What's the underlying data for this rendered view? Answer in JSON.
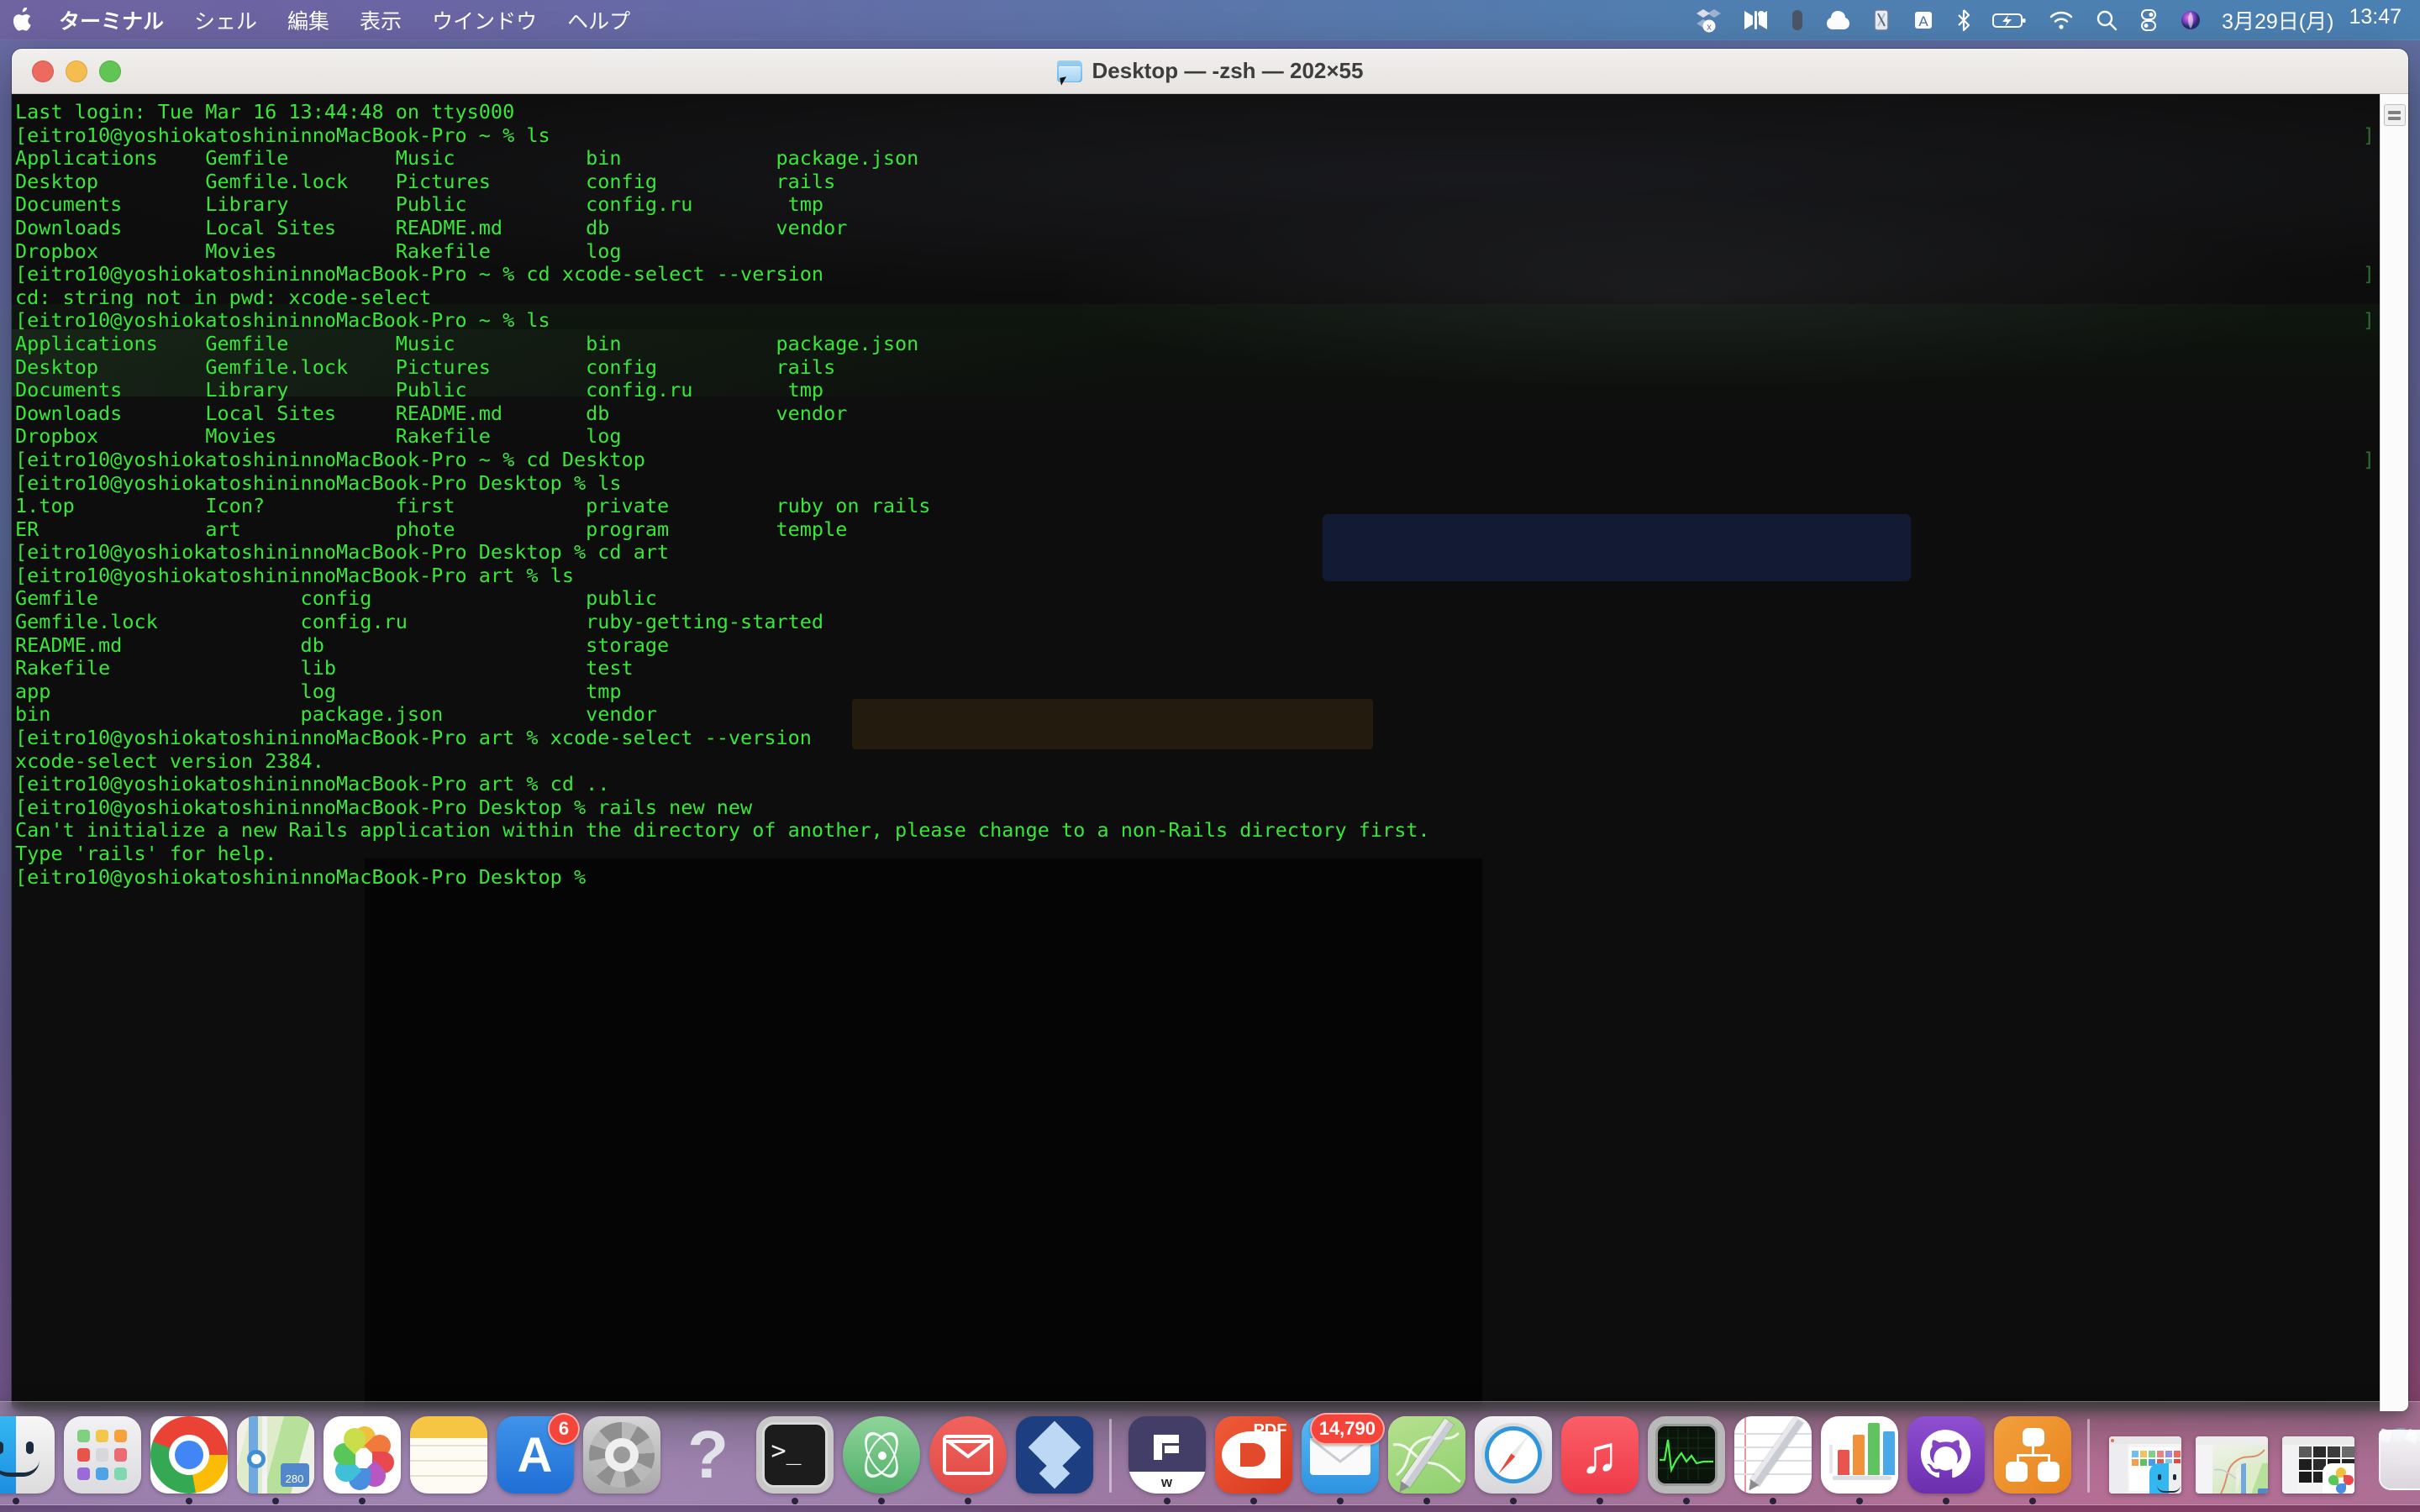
{
  "menubar": {
    "apple_icon": "apple-logo",
    "items": [
      {
        "label": "ターミナル",
        "bold": true
      },
      {
        "label": "シェル",
        "bold": false
      },
      {
        "label": "編集",
        "bold": false
      },
      {
        "label": "表示",
        "bold": false
      },
      {
        "label": "ウインドウ",
        "bold": false
      },
      {
        "label": "ヘルプ",
        "bold": false
      }
    ],
    "status_icons": [
      "dropbox-icon",
      "music-visualizer-icon",
      "capsule-icon",
      "cloud-icon",
      "battery-stat-icon",
      "input-source-A-icon",
      "bluetooth-icon",
      "battery-charging-icon",
      "wifi-icon",
      "spotlight-search-icon",
      "control-center-icon",
      "siri-icon"
    ],
    "date": "3月29日(月)",
    "time": "13:47"
  },
  "window": {
    "title": "Desktop — -zsh — 202×55",
    "folder_icon": "folder-icon",
    "controls": {
      "close": "close-button",
      "minimize": "minimize-button",
      "zoom": "zoom-button"
    },
    "gutter_grip": "resize-grip-icon"
  },
  "terminal": {
    "prompt_home": "[eitro10@yoshiokatoshininnoMacBook-Pro ~ % ",
    "prompt_desktop": "[eitro10@yoshiokatoshininnoMacBook-Pro Desktop % ",
    "prompt_art": "[eitro10@yoshiokatoshininnoMacBook-Pro art % ",
    "lines": [
      "Last login: Tue Mar 16 13:44:48 on ttys000",
      "[eitro10@yoshiokatoshininnoMacBook-Pro ~ % ls",
      "Applications    Gemfile         Music           bin             package.json",
      "Desktop         Gemfile.lock    Pictures        config          rails",
      "Documents       Library         Public          config.ru        tmp",
      "Downloads       Local Sites     README.md       db              vendor",
      "Dropbox         Movies          Rakefile        log",
      "[eitro10@yoshiokatoshininnoMacBook-Pro ~ % cd xcode-select --version",
      "cd: string not in pwd: xcode-select",
      "[eitro10@yoshiokatoshininnoMacBook-Pro ~ % ls",
      "Applications    Gemfile         Music           bin             package.json",
      "Desktop         Gemfile.lock    Pictures        config          rails",
      "Documents       Library         Public          config.ru        tmp",
      "Downloads       Local Sites     README.md       db              vendor",
      "Dropbox         Movies          Rakefile        log",
      "[eitro10@yoshiokatoshininnoMacBook-Pro ~ % cd Desktop",
      "[eitro10@yoshiokatoshininnoMacBook-Pro Desktop % ls",
      "1.top           Icon?           first           private         ruby on rails",
      "ER              art             phote           program         temple",
      "[eitro10@yoshiokatoshininnoMacBook-Pro Desktop % cd art",
      "[eitro10@yoshiokatoshininnoMacBook-Pro art % ls",
      "Gemfile                 config                  public",
      "Gemfile.lock            config.ru               ruby-getting-started",
      "README.md               db                      storage",
      "Rakefile                lib                     test",
      "app                     log                     tmp",
      "bin                     package.json            vendor",
      "[eitro10@yoshiokatoshininnoMacBook-Pro art % xcode-select --version",
      "xcode-select version 2384.",
      "[eitro10@yoshiokatoshininnoMacBook-Pro art % cd ..",
      "[eitro10@yoshiokatoshininnoMacBook-Pro Desktop % rails new new",
      "Can't initialize a new Rails application within the directory of another, please change to a non-Rails directory first.",
      "Type 'rails' for help.",
      "[eitro10@yoshiokatoshininnoMacBook-Pro Desktop % "
    ],
    "edge_brackets": [
      "]",
      "]",
      "]",
      "]"
    ],
    "colors": {
      "text": "#39e639",
      "background": "#0d0d0d"
    }
  },
  "dock": {
    "items": [
      {
        "name": "finder",
        "label": "Finder",
        "running": true,
        "badge": null
      },
      {
        "name": "launchpad",
        "label": "Launchpad",
        "running": false,
        "badge": null
      },
      {
        "name": "google-chrome",
        "label": "Google Chrome",
        "running": true,
        "badge": null
      },
      {
        "name": "maps",
        "label": "Maps",
        "running": true,
        "badge": null
      },
      {
        "name": "photos",
        "label": "Photos",
        "running": true,
        "badge": null
      },
      {
        "name": "notes",
        "label": "Notes",
        "running": false,
        "badge": null
      },
      {
        "name": "app-store",
        "label": "App Store",
        "running": false,
        "badge": "6"
      },
      {
        "name": "system-preferences",
        "label": "System Preferences",
        "running": false,
        "badge": null
      },
      {
        "name": "help-viewer",
        "label": "Help",
        "running": false,
        "badge": null
      },
      {
        "name": "terminal",
        "label": "Terminal",
        "running": true,
        "badge": null
      },
      {
        "name": "atom",
        "label": "Atom",
        "running": true,
        "badge": null
      },
      {
        "name": "spark-mail",
        "label": "Mail",
        "running": true,
        "badge": null
      },
      {
        "name": "dropbox",
        "label": "Dropbox",
        "running": false,
        "badge": null
      },
      {
        "name": "filmage",
        "label": "Filmage",
        "running": true,
        "badge": null
      },
      {
        "name": "pdf-expert",
        "label": "PDF Expert",
        "running": true,
        "badge": null
      },
      {
        "name": "apple-mail",
        "label": "Mail",
        "running": true,
        "badge": "14,790"
      },
      {
        "name": "maps-markup",
        "label": "Maps",
        "running": true,
        "badge": null
      },
      {
        "name": "safari",
        "label": "Safari",
        "running": true,
        "badge": null
      },
      {
        "name": "music",
        "label": "Music",
        "running": true,
        "badge": null
      },
      {
        "name": "activity-monitor",
        "label": "Activity Monitor",
        "running": true,
        "badge": null
      },
      {
        "name": "textedit",
        "label": "TextEdit",
        "running": true,
        "badge": null
      },
      {
        "name": "numbers",
        "label": "Numbers",
        "running": true,
        "badge": null
      },
      {
        "name": "github-desktop",
        "label": "GitHub Desktop",
        "running": true,
        "badge": null
      },
      {
        "name": "omnigraffle",
        "label": "OmniGraffle",
        "running": true,
        "badge": null
      }
    ],
    "minimized": [
      {
        "name": "minimized-finder-window",
        "app": "Finder"
      },
      {
        "name": "minimized-maps-window",
        "app": "Maps"
      },
      {
        "name": "minimized-photos-window",
        "app": "Photos"
      }
    ],
    "trash": {
      "name": "trash",
      "label": "Trash",
      "full": true
    }
  }
}
